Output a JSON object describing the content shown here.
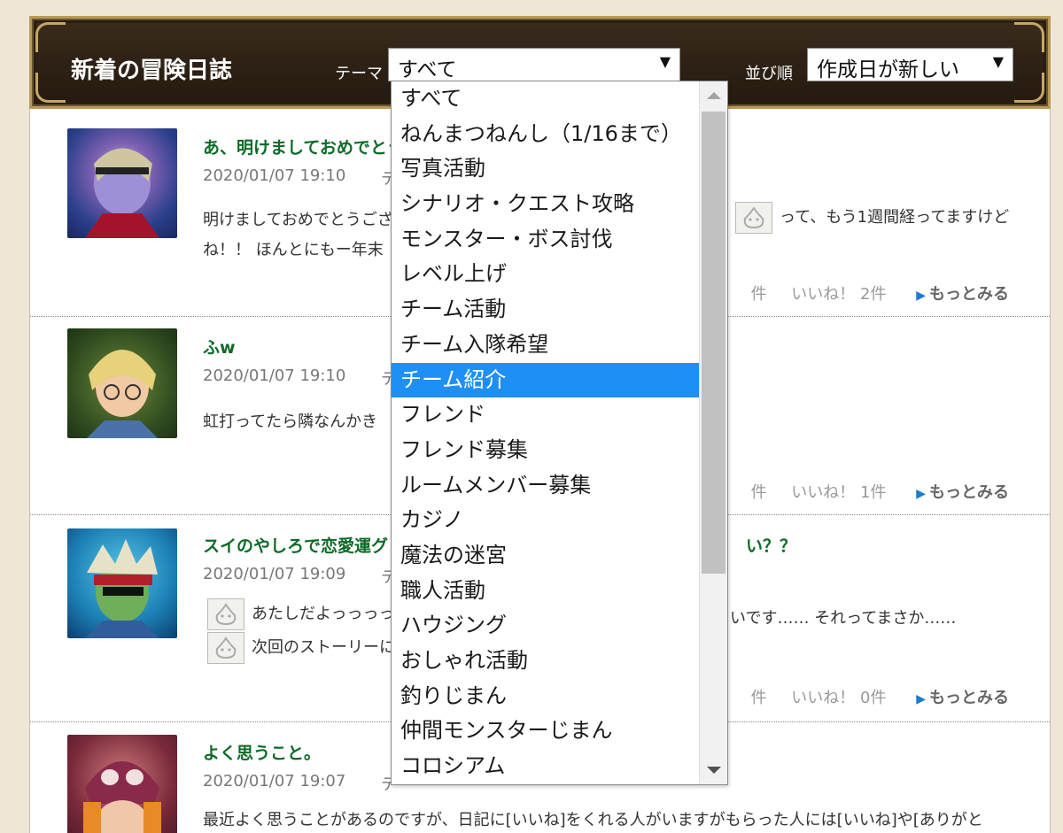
{
  "header": {
    "title": "新着の冒険日誌",
    "theme_label": "テーマ",
    "theme_value": "すべて",
    "sort_label": "並び順",
    "sort_value": "作成日が新しい"
  },
  "theme_options": [
    "すべて",
    "ねんまつねんし（1/16まで）",
    "写真活動",
    "シナリオ・クエスト攻略",
    "モンスター・ボス討伐",
    "レベル上げ",
    "チーム活動",
    "チーム入隊希望",
    "チーム紹介",
    "フレンド",
    "フレンド募集",
    "ルームメンバー募集",
    "カジノ",
    "魔法の迷宮",
    "職人活動",
    "ハウジング",
    "おしゃれ活動",
    "釣りじまん",
    "仲間モンスターじまん",
    "コロシアム"
  ],
  "highlighted_option": "チーム紹介",
  "entries": [
    {
      "title": "あ、明けましておめでとう",
      "date": "2020/01/07 19:10",
      "theme_frag": "テ",
      "body_left": "明けましておめでとうござ",
      "body_right": "って、もう1週間経ってますけど",
      "body_line2": "ね！！ ほんとにもー年末",
      "comments": "件",
      "likes": "いいね！ 2件",
      "more": "もっとみる"
    },
    {
      "title": "ふw",
      "date": "2020/01/07 19:10",
      "theme_frag": "テ",
      "body_left": "虹打ってたら隣なんかき",
      "comments": "件",
      "likes": "いいね！ 1件",
      "more": "もっとみる"
    },
    {
      "title": "スイのやしろで恋愛運グ",
      "title_right": "い？？",
      "date": "2020/01/07 19:09",
      "theme_frag": "テ",
      "body_left": "あたしだよっっっっ(",
      "body_right": "いです…… それってまさか……",
      "body_line2": "次回のストーリーに",
      "comments": "件",
      "likes": "いいね！ 0件",
      "more": "もっとみる"
    },
    {
      "title": "よく思うこと。",
      "date": "2020/01/07 19:07",
      "theme_frag": "テ",
      "body_left": "最近よく思うことがあるのですが、日記に[いいね]をくれる人がいますがもらった人には[いいね]や[ありがと"
    }
  ]
}
